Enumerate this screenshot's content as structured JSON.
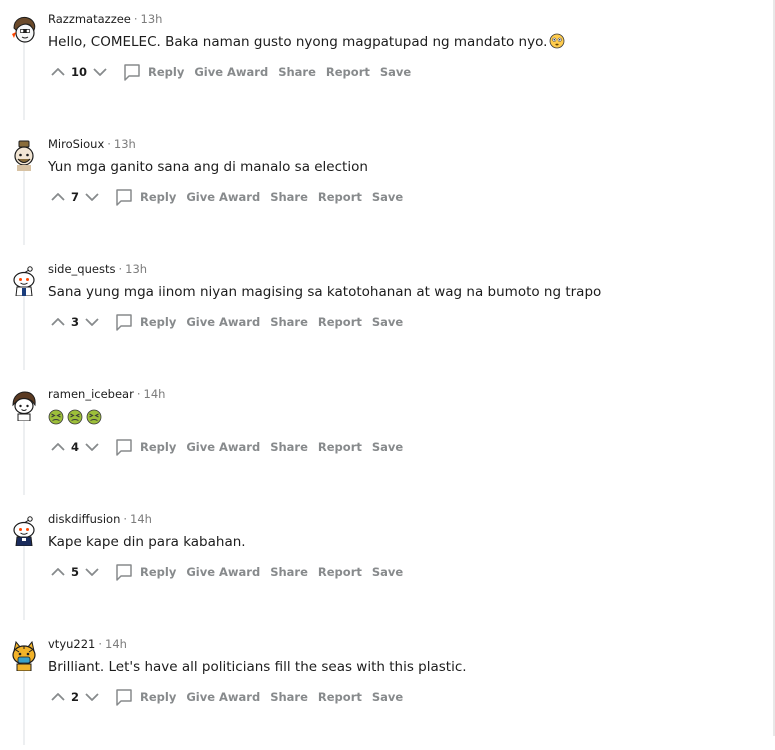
{
  "actions": {
    "reply": "Reply",
    "give_award": "Give Award",
    "share": "Share",
    "report": "Report",
    "save": "Save"
  },
  "comments": [
    {
      "username": "Razzmatazzee",
      "time": "13h",
      "text": "Hello, COMELEC. Baka naman gusto nyong magpatupad ng mandato nyo.",
      "score": "10",
      "emoji": "flushed-face-icon"
    },
    {
      "username": "MiroSioux",
      "time": "13h",
      "text": "Yun mga ganito sana ang di manalo sa election",
      "score": "7"
    },
    {
      "username": "side_quests",
      "time": "13h",
      "text": "Sana yung mga iinom niyan magising sa katotohanan at wag na bumoto ng trapo",
      "score": "3"
    },
    {
      "username": "ramen_icebear",
      "time": "14h",
      "text": "",
      "score": "4",
      "emoji": "nauseated-face-icon x3"
    },
    {
      "username": "diskdiffusion",
      "time": "14h",
      "text": "Kape kape din para kabahan.",
      "score": "5"
    },
    {
      "username": "vtyu221",
      "time": "14h",
      "text": "Brilliant. Let's have all politicians fill the seas with this plastic.",
      "score": "2"
    }
  ],
  "colors": {
    "meta": "#7c7c7c",
    "action": "#878a8c",
    "text": "#1c1c1c",
    "thread_line": "#edeff1"
  }
}
